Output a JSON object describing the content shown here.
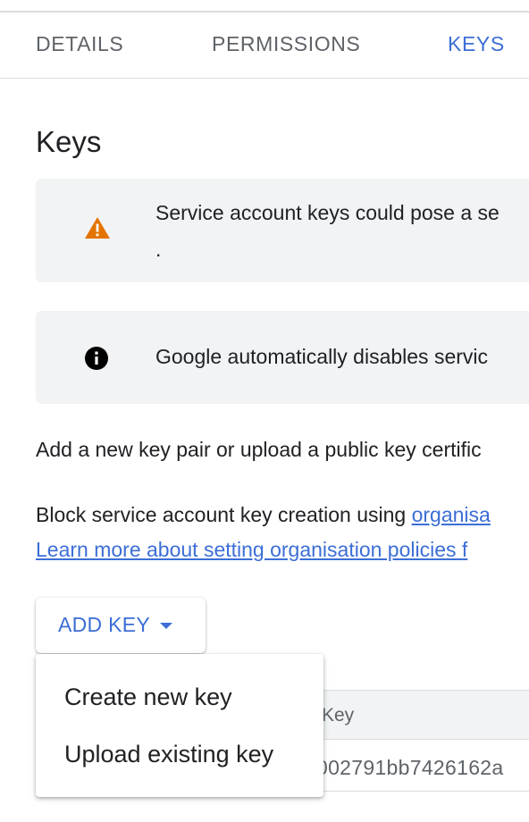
{
  "tabs": [
    {
      "label": "DETAILS",
      "active": false
    },
    {
      "label": "PERMISSIONS",
      "active": false
    },
    {
      "label": "KEYS",
      "active": true
    }
  ],
  "page_title": "Keys",
  "banners": {
    "warning": {
      "icon": "warning-icon",
      "text": "Service account keys could pose a se",
      "text2": "."
    },
    "info": {
      "icon": "info-icon",
      "text": "Google automatically disables servic"
    }
  },
  "body": {
    "para1": "Add a new key pair or upload a public key certific",
    "para2_text": "Block service account key creation using ",
    "para2_link": "organisa",
    "para3_link": "Learn more about setting organisation policies f"
  },
  "add_key": {
    "label": "ADD KEY",
    "icon": "caret-down-icon"
  },
  "menu": {
    "items": [
      {
        "label": "Create new key"
      },
      {
        "label": "Upload existing key"
      }
    ]
  },
  "table": {
    "header_key": "Key",
    "row_key": "002791bb7426162a"
  },
  "colors": {
    "accent": "#3c6ed6",
    "warning": "#e37400",
    "banner_bg": "#f1f3f4"
  }
}
